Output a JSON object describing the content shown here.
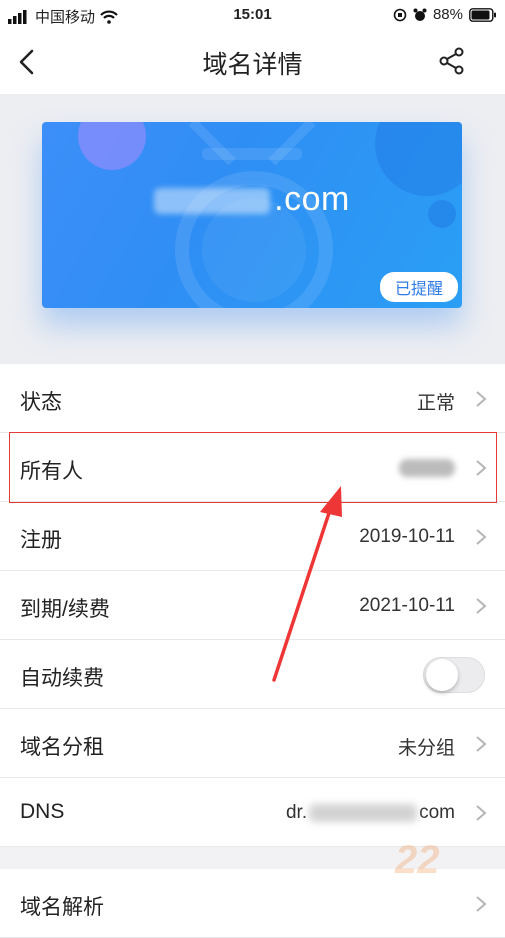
{
  "status_bar": {
    "carrier": "中国移动",
    "time": "15:01",
    "battery": "88%"
  },
  "nav": {
    "title": "域名详情",
    "back_icon": "chevron-left-icon",
    "share_icon": "share-icon"
  },
  "card": {
    "domain_suffix": ".com",
    "badge": "已提醒"
  },
  "rows": [
    {
      "label": "状态",
      "value": "正常"
    },
    {
      "label": "所有人",
      "value": ""
    },
    {
      "label": "注册",
      "value": "2019-10-11"
    },
    {
      "label": "到期/续费",
      "value": "2021-10-11"
    },
    {
      "label": "自动续费",
      "toggle": false
    },
    {
      "label": "域名分租",
      "value": "未分组"
    },
    {
      "label": "DNS",
      "value_prefix": "dr.",
      "value_suffix": "com"
    }
  ],
  "section2": {
    "label": "域名解析"
  },
  "watermark": "22"
}
